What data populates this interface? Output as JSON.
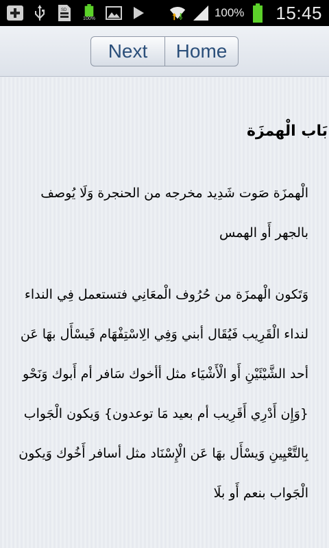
{
  "status_bar": {
    "battery_percent": "100%",
    "time": "15:45",
    "small_battery_label": "100%",
    "icons": [
      "add-icon",
      "usb-icon",
      "sd-card-icon",
      "battery-full-icon",
      "image-icon",
      "play-icon",
      "wifi-icon",
      "signal-icon",
      "battery-icon"
    ]
  },
  "toolbar": {
    "next_label": "Next",
    "home_label": "Home"
  },
  "content": {
    "heading": "بَاب الْهمزَة",
    "paragraph1": [
      "الْهمزَة صَوت شَدِيد مخرجه من الحنجرة وَلَا يُوصف",
      "بالجهر أَو الهمس"
    ],
    "paragraph2": [
      "وَتَكون الْهمزَة من حُرُوف الْمعَانِي فتستعمل فِي النداء",
      "لنداء الْقَرِيب فَيُقَال أبني وَفِي الِاسْتِفْهَام فَيسْأَل بهَا عَن",
      "أحد الشَّيْئَيْنِ أَو الْأَشْيَاء مثل أأخوك سَافر أم أَبوك وَنَحْو",
      "{وَإِن أَدْرِي أَقَرِيب أم بعيد مَا توعدون} وَيكون الْجَواب",
      "بِالتَّعْيِينِ وَيسْأَل بهَا عَن الْإِسْنَاد مثل أسافر أَخُوك وَيكون",
      "الْجَواب بنعم أَو بلَا"
    ]
  }
}
